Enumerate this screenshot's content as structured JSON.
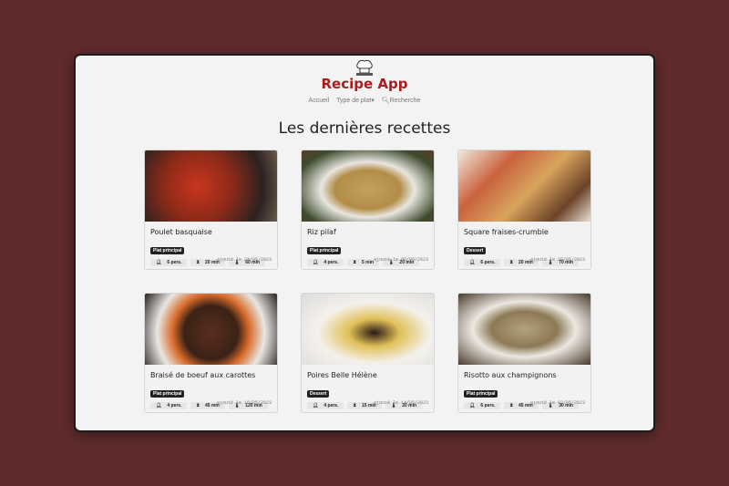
{
  "header": {
    "brand": "Recipe App",
    "nav": [
      "Accueil",
      "Type de plat",
      "Recherche"
    ]
  },
  "page_title": "Les dernières recettes",
  "recipes": [
    {
      "title": "Poulet basquaise",
      "type": "Plat principal",
      "people": "6 pers.",
      "prep": "20 min",
      "cook": "60 min",
      "date": "ajouté le 24/05/2023"
    },
    {
      "title": "Riz pilaf",
      "type": "Plat principal",
      "people": "4 pers.",
      "prep": "5 min",
      "cook": "20 min",
      "date": "ajouté le 06/06/2023"
    },
    {
      "title": "Square fraises-crumble",
      "type": "Dessert",
      "people": "6 pers.",
      "prep": "20 min",
      "cook": "70 min",
      "date": "ajouté le 28/05/2023"
    },
    {
      "title": "Braisé de boeuf aux carottes",
      "type": "Plat principal",
      "people": "4 pers.",
      "prep": "45 min",
      "cook": "120 min",
      "date": "ajouté le 16/05/2023"
    },
    {
      "title": "Poires Belle Hélène",
      "type": "Dessert",
      "people": "4 pers.",
      "prep": "15 min",
      "cook": "20 min",
      "date": "ajouté le 14/05/2023"
    },
    {
      "title": "Risotto aux champignons",
      "type": "Plat principal",
      "people": "6 pers.",
      "prep": "45 min",
      "cook": "30 min",
      "date": "ajouté le 02/05/2023"
    }
  ]
}
